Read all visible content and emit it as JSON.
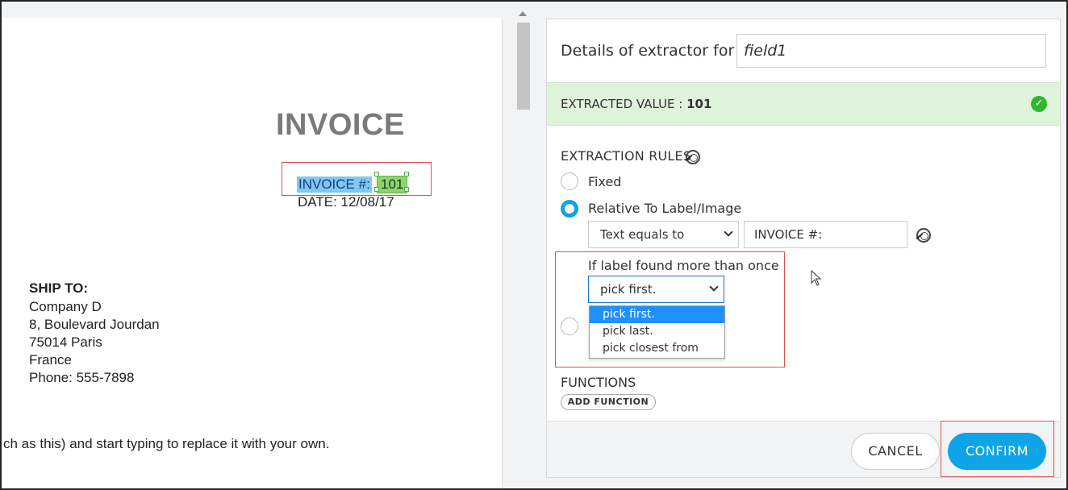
{
  "document": {
    "title": "INVOICE",
    "invoice_label": "INVOICE #:",
    "invoice_value": "101",
    "date_line": "DATE:  12/08/17",
    "ship_to_label": "SHIP TO:",
    "address": [
      "Company D",
      "8, Boulevard Jourdan",
      "75014 Paris",
      "France",
      "Phone:  555-7898"
    ],
    "body_line": "ch as this) and start typing to replace it with your own."
  },
  "panel": {
    "details_label": "Details of extractor for",
    "field_name": "field1",
    "extracted_label": "EXTRACTED VALUE : ",
    "extracted_value": "101",
    "rules_title": "EXTRACTION RULES",
    "rule_fixed": "Fixed",
    "rule_relative": "Relative To Label/Image",
    "match_mode": "Text equals to",
    "label_text": "INVOICE #:",
    "more_than_once_label": "If label found more than once",
    "pick_selected": "pick first.",
    "pick_options": [
      "pick first.",
      "pick last.",
      "pick closest from"
    ],
    "functions_title": "FUNCTIONS",
    "add_function": "ADD FUNCTION",
    "cancel": "CANCEL",
    "confirm": "CONFIRM"
  },
  "colors": {
    "accent": "#0da4e8",
    "success": "#2eb82e",
    "extracted_bg": "#dff2da",
    "callout": "#d9534f"
  },
  "icons": [
    "target-icon",
    "check-icon",
    "chevron-down-icon",
    "scroll-up-icon",
    "cursor-icon"
  ]
}
